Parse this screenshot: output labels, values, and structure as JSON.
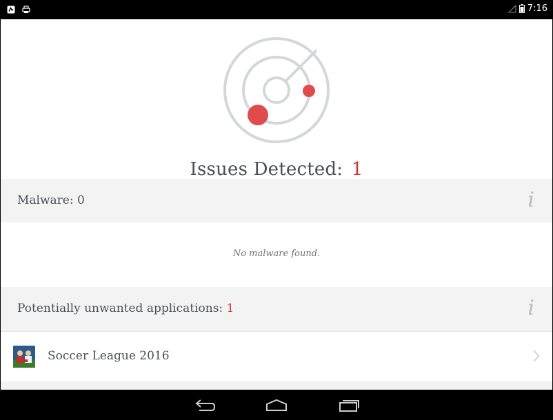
{
  "status_bar": {
    "time": "7:16",
    "left_icons": [
      "app-notification-icon",
      "printer-icon"
    ],
    "right_icons": [
      "no-signal-icon",
      "battery-icon"
    ]
  },
  "scan_result": {
    "heading": "Issues Detected:",
    "issue_count": "1",
    "icon": "radar-icon"
  },
  "malware_section": {
    "label": "Malware: 0",
    "info_icon": "i",
    "empty_message": "No malware found."
  },
  "pua_section": {
    "label": "Potentially unwanted applications:",
    "count": "1",
    "info_icon": "i",
    "items": [
      {
        "name": "Soccer League 2016",
        "icon": "soccer-app-icon"
      }
    ]
  },
  "nav_bar": {
    "buttons": [
      "back-icon",
      "home-icon",
      "recents-icon"
    ]
  },
  "colors": {
    "accent_red": "#cc3333",
    "radar_dot": "#e04b4b",
    "radar_ring": "#d4d7da",
    "text": "#4a4f55",
    "section_bg": "#f3f3f3"
  }
}
